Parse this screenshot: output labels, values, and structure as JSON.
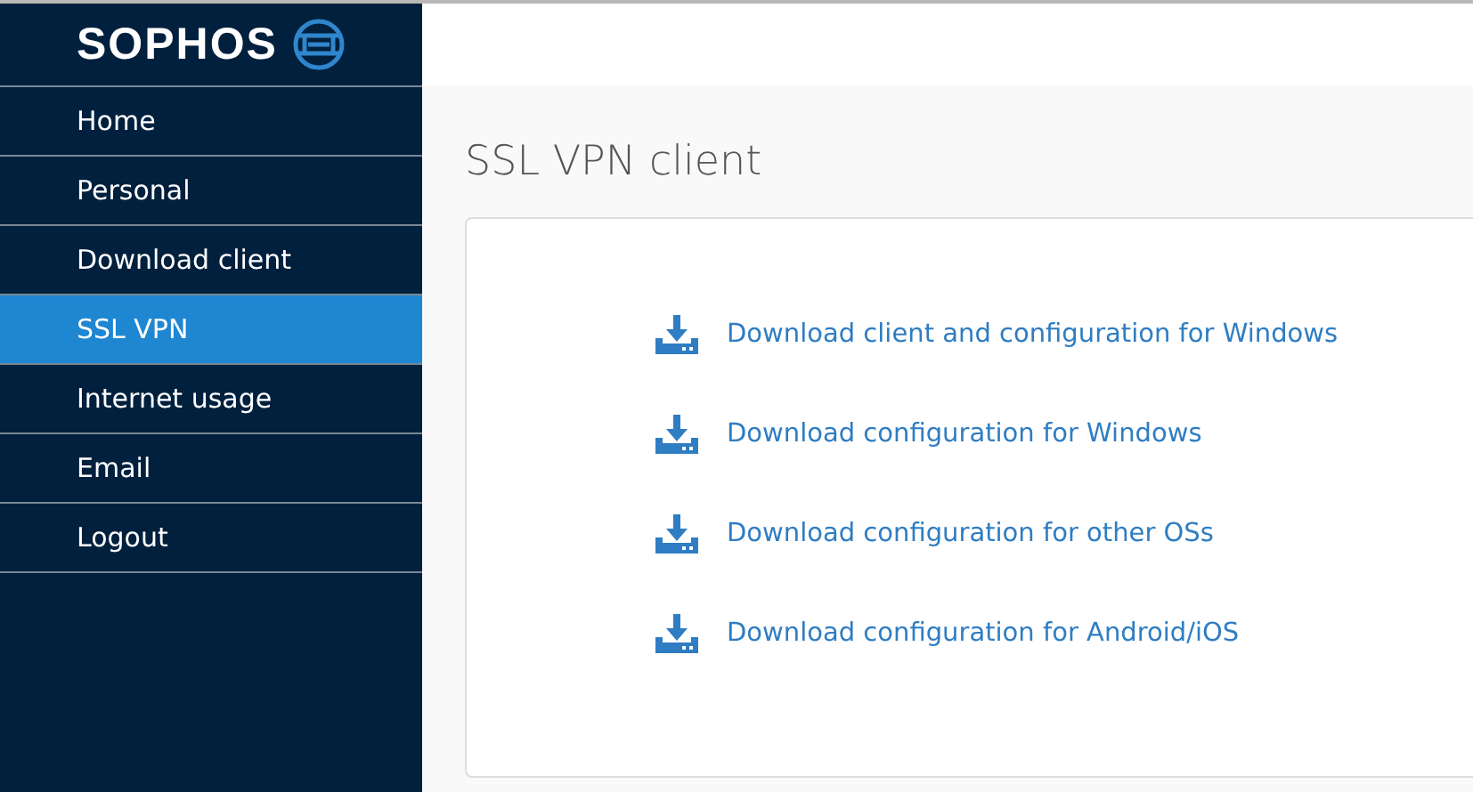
{
  "logo": {
    "text": "SOPHOS"
  },
  "sidebar": {
    "items": [
      {
        "label": "Home",
        "selected": false
      },
      {
        "label": "Personal",
        "selected": false
      },
      {
        "label": "Download client",
        "selected": false
      },
      {
        "label": "SSL VPN",
        "selected": true
      },
      {
        "label": "Internet usage",
        "selected": false
      },
      {
        "label": "Email",
        "selected": false
      },
      {
        "label": "Logout",
        "selected": false
      }
    ]
  },
  "page": {
    "title": "SSL VPN client",
    "links": [
      {
        "label": "Download client and configuration for Windows"
      },
      {
        "label": "Download configuration for Windows"
      },
      {
        "label": "Download configuration for other OSs"
      },
      {
        "label": "Download configuration for Android/iOS"
      }
    ]
  }
}
